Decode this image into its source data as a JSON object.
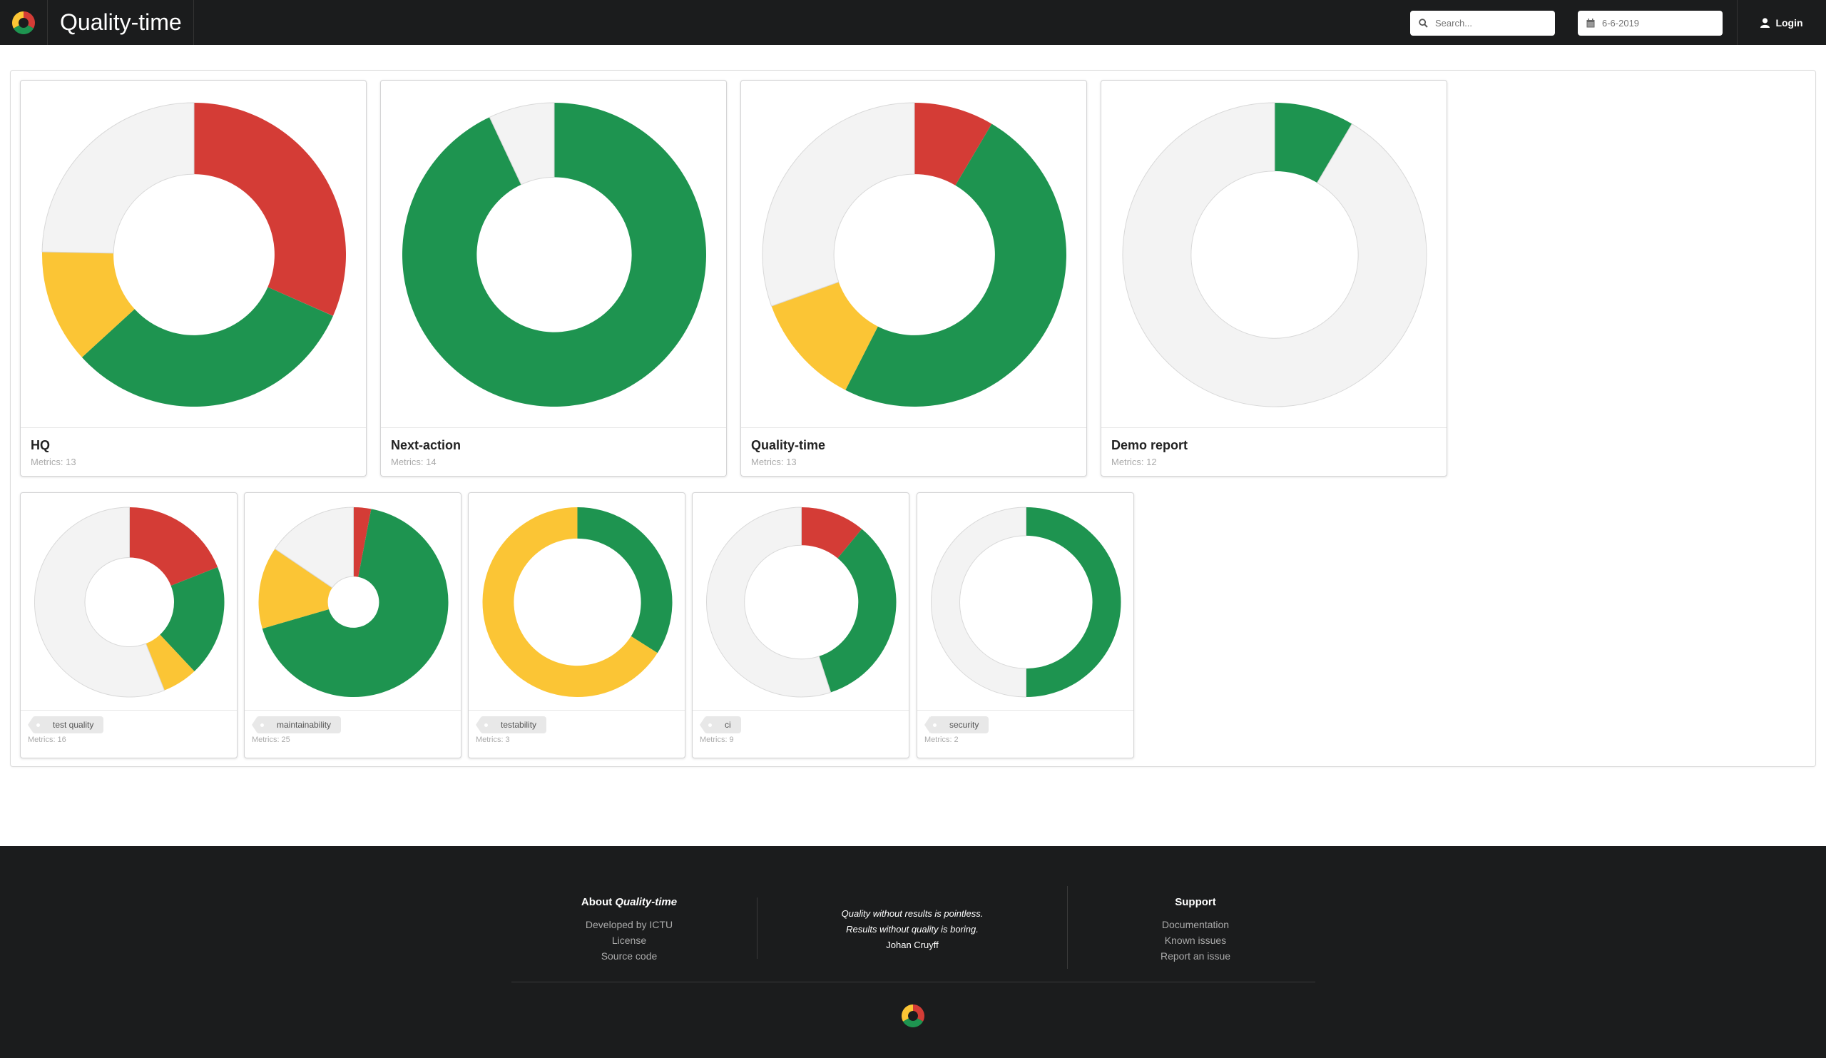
{
  "header": {
    "app_title": "Quality-time",
    "search_placeholder": "Search...",
    "date_placeholder": "6-6-2019",
    "login_label": "Login",
    "logo_icon": "quality-time-logo",
    "search_icon": "search-icon",
    "calendar_icon": "calendar-icon",
    "user_icon": "user-icon"
  },
  "colors": {
    "red": "#d43c36",
    "green": "#1e9450",
    "yellow": "#fbc535",
    "grey": "#f3f3f3"
  },
  "reports": [
    {
      "title": "HQ",
      "metrics_label": "Metrics: 13",
      "segments": {
        "red": 0.316,
        "green": 0.316,
        "yellow": 0.121,
        "grey": 0.247
      }
    },
    {
      "title": "Next-action",
      "metrics_label": "Metrics: 14",
      "segments": {
        "red": 0.0,
        "green": 0.93,
        "yellow": 0.0,
        "grey": 0.07
      }
    },
    {
      "title": "Quality-time",
      "metrics_label": "Metrics: 13",
      "segments": {
        "red": 0.085,
        "green": 0.49,
        "yellow": 0.12,
        "grey": 0.305
      }
    },
    {
      "title": "Demo report",
      "metrics_label": "Metrics: 12",
      "segments": {
        "red": 0.0,
        "green": 0.085,
        "yellow": 0.0,
        "grey": 0.915
      }
    }
  ],
  "tags": [
    {
      "tag": "test quality",
      "metrics_label": "Metrics: 16",
      "segments": {
        "red": 0.19,
        "green": 0.19,
        "yellow": 0.06,
        "grey": 0.56
      }
    },
    {
      "tag": "maintainability",
      "metrics_label": "Metrics: 25",
      "segments": {
        "red": 0.03,
        "green": 0.675,
        "yellow": 0.14,
        "grey": 0.155
      }
    },
    {
      "tag": "testability",
      "metrics_label": "Metrics: 3",
      "segments": {
        "red": 0.0,
        "green": 0.34,
        "yellow": 0.66,
        "grey": 0.0
      }
    },
    {
      "tag": "ci",
      "metrics_label": "Metrics: 9",
      "segments": {
        "red": 0.11,
        "green": 0.34,
        "yellow": 0.0,
        "grey": 0.55
      }
    },
    {
      "tag": "security",
      "metrics_label": "Metrics: 2",
      "segments": {
        "red": 0.0,
        "green": 0.5,
        "yellow": 0.0,
        "grey": 0.5
      }
    }
  ],
  "footer": {
    "about_title_prefix": "About ",
    "about_title_app": "Quality-time",
    "about_links": [
      "Developed by ICTU",
      "License",
      "Source code"
    ],
    "quote_line1": "Quality without results is pointless.",
    "quote_line2": "Results without quality is boring.",
    "quote_author": "Johan Cruyff",
    "support_title": "Support",
    "support_links": [
      "Documentation",
      "Known issues",
      "Report an issue"
    ]
  }
}
